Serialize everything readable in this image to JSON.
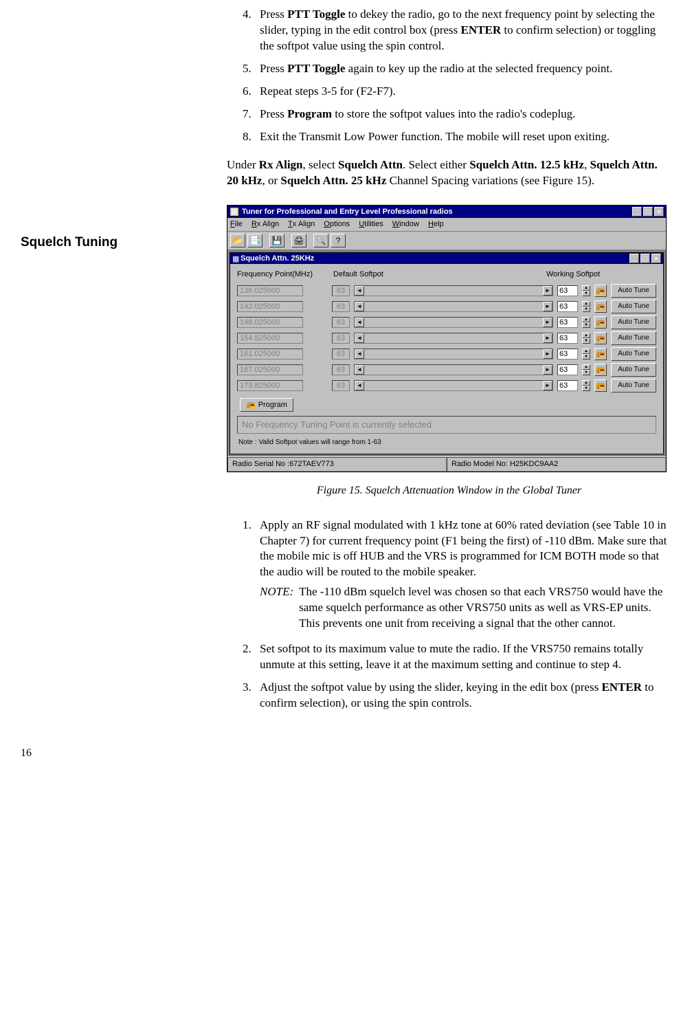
{
  "steps_top": [
    {
      "n": "4.",
      "text_a": "Press ",
      "b1": "PTT Toggle",
      "text_b": " to dekey the radio, go to the next frequency point by selecting the slider, typing in the edit control box (press ",
      "b2": "ENTER",
      "text_c": " to confirm selection) or toggling the softpot value using the spin control."
    },
    {
      "n": "5.",
      "text_a": "Press ",
      "b1": "PTT Toggle",
      "text_b": " again to key up the radio at the selected frequency point."
    },
    {
      "n": "6.",
      "text_a": "Repeat steps 3-5 for (F2-F7)."
    },
    {
      "n": "7.",
      "text_a": "Press ",
      "b1": "Program",
      "text_b": " to store the softpot values into the radio's codeplug."
    },
    {
      "n": "8.",
      "text_a": "Exit the Transmit Low Power function. The mobile will reset upon exiting."
    }
  ],
  "section_heading": "Squelch Tuning",
  "intro_text_a": "Under ",
  "intro_b1": "Rx Align",
  "intro_text_b": ", select ",
  "intro_b2": "Squelch Attn",
  "intro_text_c": ". Select either ",
  "intro_b3": "Squelch Attn. 12.5 kHz",
  "intro_text_d": ", ",
  "intro_b4": "Squelch Attn. 20 kHz",
  "intro_text_e": ", or ",
  "intro_b5": "Squelch Attn. 25 kHz",
  "intro_text_f": " Channel Spacing variations (see Figure 15).",
  "app": {
    "title": "Tuner for Professional and Entry Level Professional radios",
    "menu": [
      "File",
      "Rx Align",
      "Tx Align",
      "Options",
      "Utilities",
      "Window",
      "Help"
    ],
    "child_title": "Squelch Attn. 25KHz",
    "headers": {
      "h1": "Frequency Point(MHz)",
      "h2": "Default Softpot",
      "h3": "Working Softpot"
    },
    "rows": [
      {
        "freq": "136.025000",
        "def": "63",
        "work": "63"
      },
      {
        "freq": "142.025000",
        "def": "63",
        "work": "63"
      },
      {
        "freq": "148.025000",
        "def": "63",
        "work": "63"
      },
      {
        "freq": "154.825000",
        "def": "63",
        "work": "63"
      },
      {
        "freq": "161.025000",
        "def": "63",
        "work": "63"
      },
      {
        "freq": "167.025000",
        "def": "63",
        "work": "63"
      },
      {
        "freq": "173.825000",
        "def": "63",
        "work": "63"
      }
    ],
    "auto_tune_label": "Auto Tune",
    "program_label": "Program",
    "status_msg": "No Frequency Tuning Point is currently selected",
    "note_line": "Note : Valid Softpot values will range from 1-63",
    "status_serial": "Radio Serial No :672TAEV773",
    "status_model": "Radio Model No: H25KDC9AA2"
  },
  "figure_caption": "Figure 15. Squelch Attenuation Window in the Global Tuner",
  "steps_bottom": [
    {
      "n": "1.",
      "text": "Apply an RF signal modulated with 1 kHz tone at 60% rated deviation (see Table 10 in Chapter 7) for current frequency point (F1 being the first) of -110 dBm. Make sure that the mobile mic is off HUB and the VRS is programmed for ICM BOTH mode so that the audio will be routed to the mobile speaker.",
      "note_label": "NOTE:",
      "note_body": "The -110 dBm squelch level was chosen so that each VRS750 would have the same squelch performance as other VRS750 units as well as VRS-EP units. This prevents one unit from receiving a signal that the other cannot."
    },
    {
      "n": "2.",
      "text": "Set softpot to its maximum value to mute the radio. If the VRS750 remains totally unmute at this setting, leave it at the maximum setting and continue to step 4."
    },
    {
      "n": "3.",
      "text_a": "Adjust the softpot value by using the slider, keying in the edit box (press ",
      "b1": "ENTER",
      "text_b": " to confirm selection), or using the spin controls."
    }
  ],
  "page_num": "16"
}
